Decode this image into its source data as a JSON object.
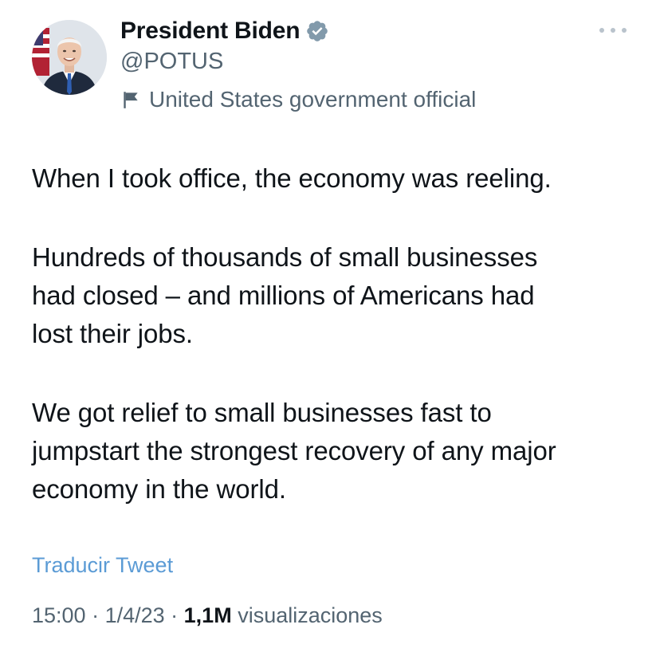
{
  "author": {
    "display_name": "President Biden",
    "handle": "@POTUS",
    "affiliation": "United States government official",
    "verified_badge_color": "#829aab"
  },
  "tweet": {
    "paragraphs": [
      "When I took office, the economy was reeling.",
      "Hundreds of thousands of small businesses\nhad closed – and millions of Americans had\nlost their jobs.",
      "We got relief to small businesses fast to\njumpstart the strongest recovery of any major\neconomy in the world."
    ],
    "translate_label": "Traducir Tweet",
    "time": "15:00",
    "separator": " · ",
    "date": "1/4/23",
    "views_count": "1,1M",
    "views_label": " visualizaciones"
  },
  "icons": {
    "verified": "verified-badge-icon",
    "flag": "flag-icon",
    "more": "more-options-icon"
  },
  "colors": {
    "link": "#5b9bd5",
    "secondary_text": "#536471",
    "primary_text": "#0f1419"
  }
}
